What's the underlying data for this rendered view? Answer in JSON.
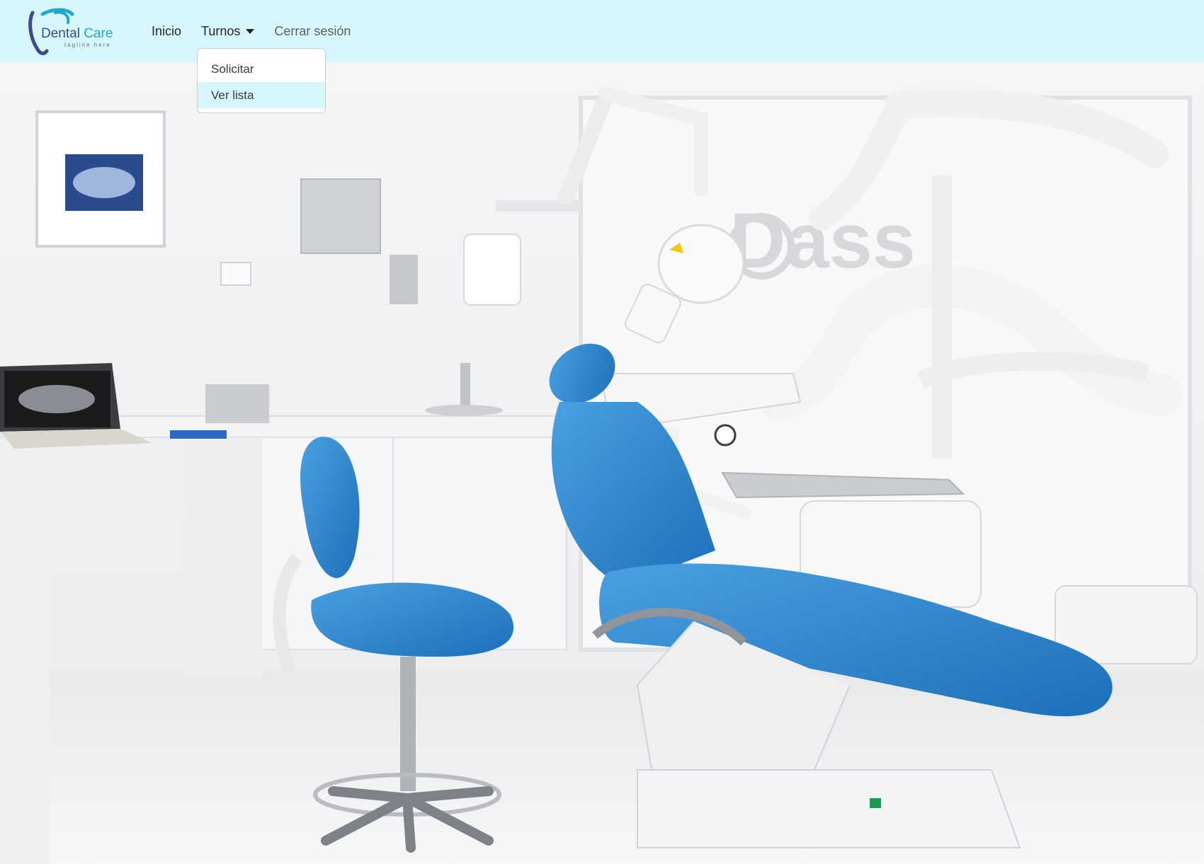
{
  "brand": {
    "name_part1": "Dental",
    "name_part2": "Care",
    "tagline": "tagline here",
    "colors": {
      "primary": "#3f4a86",
      "accent": "#23a8c8"
    }
  },
  "nav": {
    "items": [
      {
        "label": "Inicio"
      },
      {
        "label": "Turnos"
      },
      {
        "label": "Cerrar sesión"
      }
    ]
  },
  "dropdown": {
    "items": [
      {
        "label": "Solicitar"
      },
      {
        "label": "Ver lista"
      }
    ]
  },
  "hero": {
    "watermark_text": "Dass",
    "image_name": "dental-office-photo"
  },
  "colors": {
    "navbar_bg": "#d7f6fc",
    "chair_blue": "#2a7fc8"
  }
}
